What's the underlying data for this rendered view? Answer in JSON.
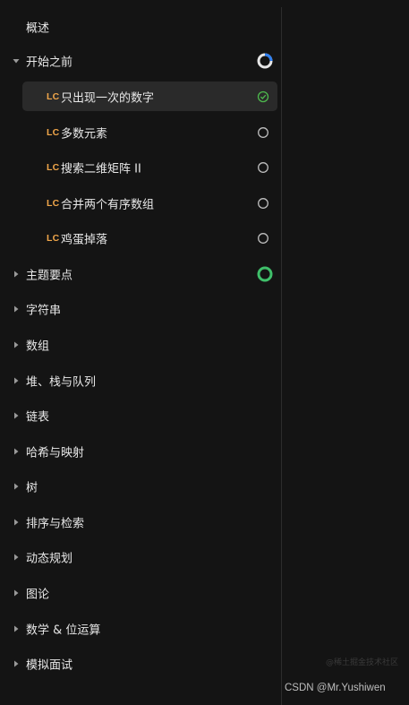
{
  "sidebar": {
    "overview_label": "概述",
    "section_open": {
      "label": "开始之前",
      "progress": 0.25,
      "problems": [
        {
          "badge": "LC",
          "label": "只出现一次的数字",
          "status": "completed",
          "active": true
        },
        {
          "badge": "LC",
          "label": "多数元素",
          "status": "not-started",
          "active": false
        },
        {
          "badge": "LC",
          "label": "搜索二维矩阵 II",
          "status": "not-started",
          "active": false
        },
        {
          "badge": "LC",
          "label": "合并两个有序数组",
          "status": "not-started",
          "active": false
        },
        {
          "badge": "LC",
          "label": "鸡蛋掉落",
          "status": "not-started",
          "active": false
        }
      ]
    },
    "section_key_points": {
      "label": "主题要点",
      "progress": 1.0
    },
    "sections": [
      {
        "label": "字符串"
      },
      {
        "label": "数组"
      },
      {
        "label": "堆、栈与队列"
      },
      {
        "label": "链表"
      },
      {
        "label": "哈希与映射"
      },
      {
        "label": "树"
      },
      {
        "label": "排序与检索"
      },
      {
        "label": "动态规划"
      },
      {
        "label": "图论"
      },
      {
        "label": "数学 & 位运算"
      },
      {
        "label": "模拟面试"
      }
    ]
  },
  "colors": {
    "background": "#141414",
    "active_row": "#2a2a2a",
    "lc_badge": "#f0a64a",
    "progress_blue": "#2f7ff0",
    "progress_green": "#3fbf6a",
    "check_green": "#4db84d"
  },
  "watermark": {
    "text": "CSDN @Mr.Yushiwen",
    "ghost": "@稀土掘金技术社区"
  }
}
